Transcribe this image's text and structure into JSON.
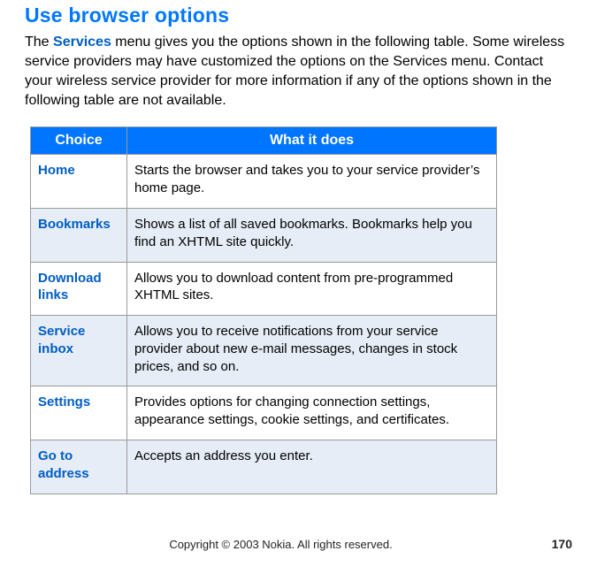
{
  "title": "Use browser options",
  "intro": {
    "pre": "The ",
    "kw": "Services",
    "post": " menu gives you the options shown in the following table. Some wireless service providers may have customized the options on the Services menu. Contact your wireless service provider for more information if any of the options shown in the following table are not available."
  },
  "table": {
    "headers": {
      "choice": "Choice",
      "desc": "What it does"
    },
    "rows": [
      {
        "choice": "Home",
        "desc": "Starts the browser and takes you to your service provider’s home page."
      },
      {
        "choice": "Bookmarks",
        "desc": "Shows a list of all saved bookmarks. Bookmarks help you find an XHTML site quickly."
      },
      {
        "choice": "Download links",
        "desc": "Allows you to download content from pre-programmed XHTML sites."
      },
      {
        "choice": "Service inbox",
        "desc": "Allows you to receive notifications from your service provider about new e-mail messages, changes in stock prices, and so on."
      },
      {
        "choice": "Settings",
        "desc": "Provides options for changing connection settings, appearance settings, cookie settings, and certificates."
      },
      {
        "choice": "Go to address",
        "desc": "Accepts an address you enter."
      }
    ]
  },
  "footer": {
    "copyright": "Copyright © 2003 Nokia. All rights reserved.",
    "page": "170"
  }
}
